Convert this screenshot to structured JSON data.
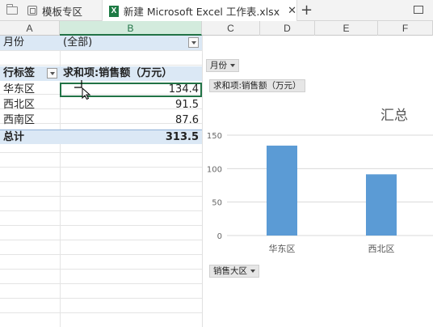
{
  "tabs": [
    {
      "label": "模板专区",
      "active": false
    },
    {
      "label": "新建 Microsoft Excel 工作表.xlsx",
      "active": true
    }
  ],
  "columns": [
    "A",
    "B",
    "C",
    "D",
    "E",
    "F"
  ],
  "selected_column": "B",
  "pivot": {
    "filter_label": "月份",
    "filter_value": "(全部)",
    "row_header": "行标签",
    "value_header": "求和项:销售额（万元）",
    "rows": [
      {
        "label": "华东区",
        "value": "134.4"
      },
      {
        "label": "西北区",
        "value": "91.5"
      },
      {
        "label": "西南区",
        "value": "87.6"
      }
    ],
    "total_label": "总计",
    "total_value": "313.5"
  },
  "chart": {
    "filter_button": "月份",
    "value_button": "求和项:销售额（万元）",
    "axis_button": "销售大区",
    "title": "汇总",
    "bar_color": "#5b9bd5"
  },
  "chart_data": {
    "type": "bar",
    "title": "汇总",
    "categories": [
      "华东区",
      "西北区"
    ],
    "values": [
      134.4,
      91.5
    ],
    "ylim": [
      0,
      150
    ],
    "yticks": [
      0,
      50,
      100,
      150
    ],
    "grid": true,
    "xlabel": "",
    "ylabel": ""
  }
}
